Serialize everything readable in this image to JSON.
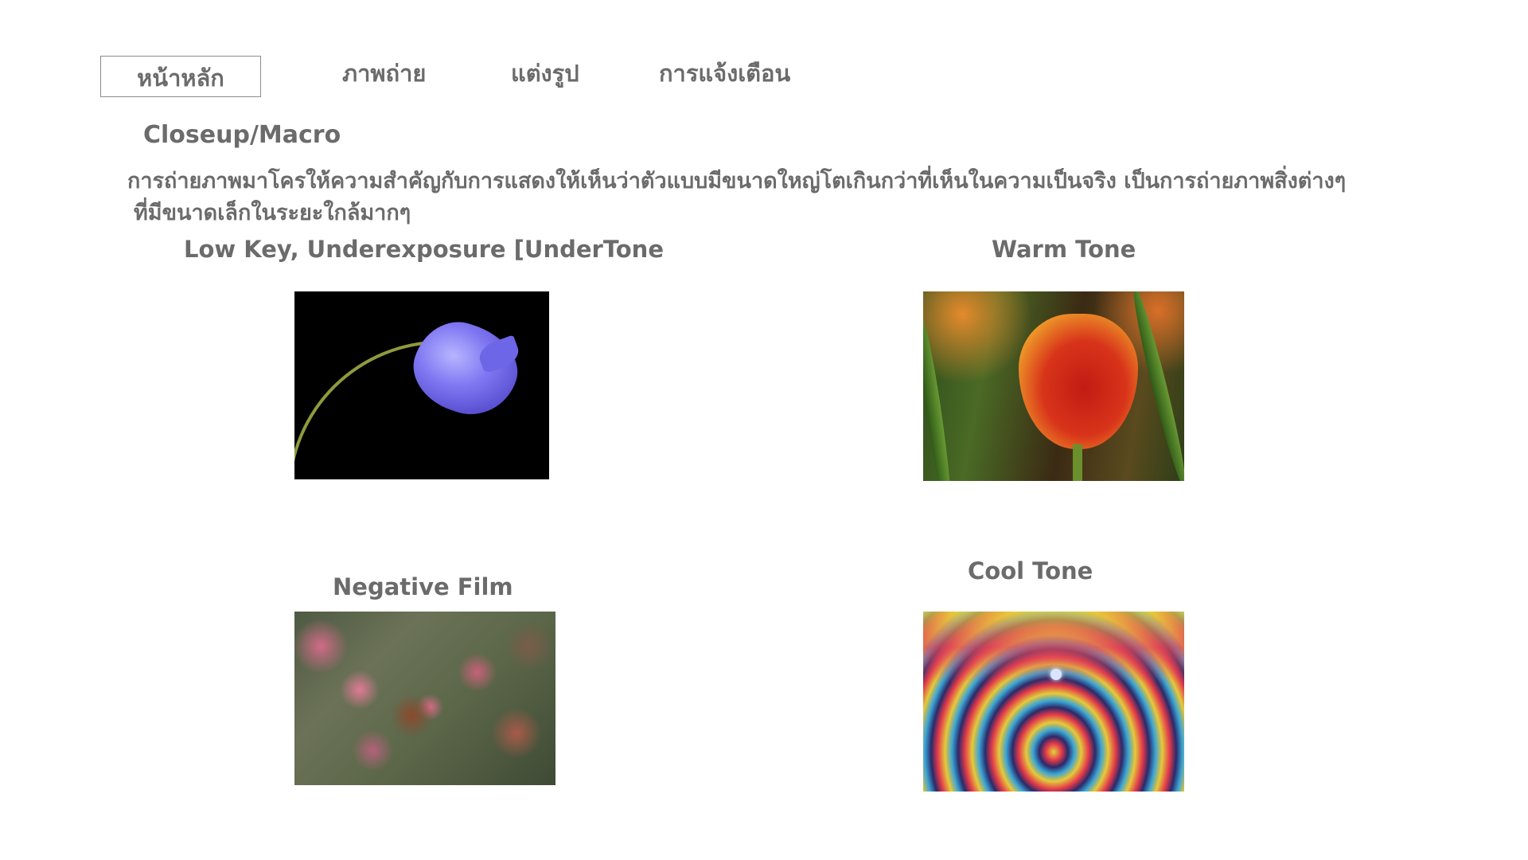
{
  "nav": {
    "items": [
      {
        "label": "หน้าหลัก",
        "active": true
      },
      {
        "label": "ภาพถ่าย",
        "active": false
      },
      {
        "label": "แต่งรูป",
        "active": false
      },
      {
        "label": "การแจ้งเตือน",
        "active": false
      }
    ]
  },
  "section": {
    "title": "Closeup/Macro",
    "description_line1": "การถ่ายภาพมาโครให้ความสำคัญกับการแสดงให้เห็นว่าตัวแบบมีขนาดใหญ่โตเกินกว่าที่เห็นในความเป็นจริง เป็นการถ่ายภาพสิ่งต่างๆ",
    "description_line2": "ที่มีขนาดเล็กในระยะใกล้มากๆ"
  },
  "cards": [
    {
      "title": "Low Key, Underexposure [UnderTone",
      "image": "blue-bellflower-photo"
    },
    {
      "title": "Warm Tone",
      "image": "red-yellow-tulip-photo"
    },
    {
      "title": "Negative Film",
      "image": "clover-flowers-photo"
    },
    {
      "title": "Cool Tone",
      "image": "water-ripple-photo"
    }
  ]
}
